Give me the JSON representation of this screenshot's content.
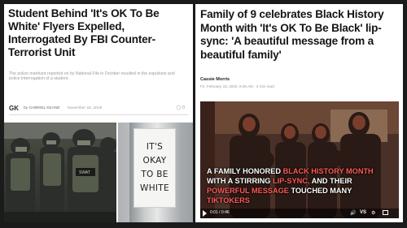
{
  "left_article": {
    "headline": "Student Behind 'It's OK To Be White' Flyers Expelled, Interrogated By FBI Counter-Terrorist Unit",
    "summary": "The police manhunt reported on by National File in October resulted in the expulsion and police interrogation of a student.",
    "logo": "GK",
    "author": "by GABRIEL KEANE",
    "date": "November 16, 2019",
    "comment_count": "0",
    "sign_lines": [
      "IT'S",
      "OKAY",
      "TO BE",
      "WHITE"
    ]
  },
  "right_article": {
    "headline": "Family of 9 celebrates Black History Month with 'It's OK To Be Black' lip-sync: 'A beautiful message from a beautiful family'",
    "author": "Cassie Morris",
    "date": "Fri, February 18, 2022, 9:36 AM · 2 min read",
    "video_caption_parts": [
      {
        "text": "A FAMILY HONORED ",
        "hl": false
      },
      {
        "text": "BLACK HISTORY MONTH",
        "hl": true
      },
      {
        "text": " WITH A STIRRING ",
        "hl": false
      },
      {
        "text": "LIP-SYNC,",
        "hl": true
      },
      {
        "text": " AND THEIR ",
        "hl": false
      },
      {
        "text": "POWERFUL MESSAGE",
        "hl": true
      },
      {
        "text": " TOUCHED MANY ",
        "hl": false
      },
      {
        "text": "TIKTOKERS",
        "hl": true
      }
    ],
    "video_time": "0:01 / 0:46",
    "video_quality": "VS"
  },
  "colors": {
    "background": "#1b1b1b",
    "caption_highlight": "#ff5a5a",
    "headline": "#151515"
  }
}
